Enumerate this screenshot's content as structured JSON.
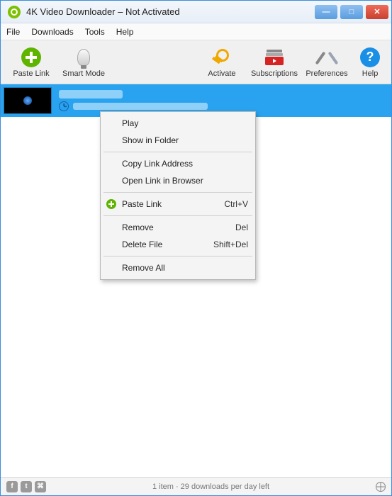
{
  "window": {
    "title": "4K Video Downloader – Not Activated"
  },
  "winbtns": {
    "min": "—",
    "max": "□",
    "close": "✕"
  },
  "menubar": [
    "File",
    "Downloads",
    "Tools",
    "Help"
  ],
  "toolbar": {
    "paste": "Paste Link",
    "smart": "Smart Mode",
    "activate": "Activate",
    "subs": "Subscriptions",
    "prefs": "Preferences",
    "help": "Help",
    "help_glyph": "?"
  },
  "context": {
    "play": "Play",
    "show_folder": "Show in Folder",
    "copy_link": "Copy Link Address",
    "open_browser": "Open Link in Browser",
    "paste": "Paste Link",
    "paste_key": "Ctrl+V",
    "remove": "Remove",
    "remove_key": "Del",
    "delete_file": "Delete File",
    "delete_key": "Shift+Del",
    "remove_all": "Remove All"
  },
  "status": {
    "text": "1 item · 29 downloads per day left"
  },
  "social": {
    "fb": "f",
    "tw": "t",
    "ig": "⌘"
  }
}
